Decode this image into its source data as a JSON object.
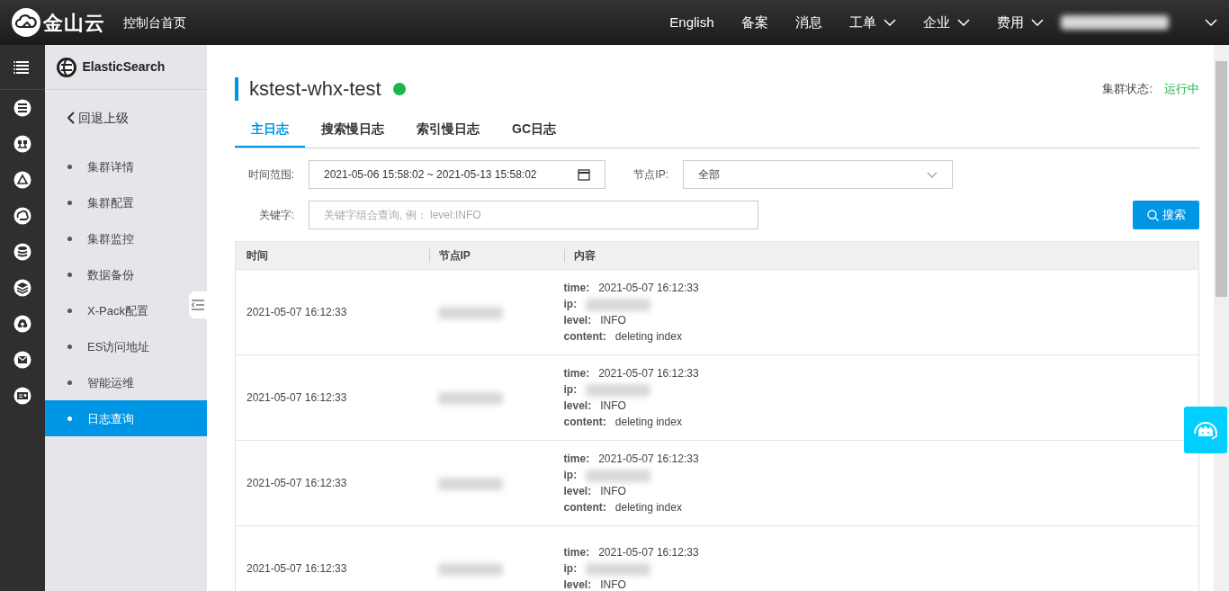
{
  "top_nav": {
    "logo_text": "金山云",
    "home": "控制台首页",
    "items": [
      {
        "label": "English",
        "dropdown": false
      },
      {
        "label": "备案",
        "dropdown": false
      },
      {
        "label": "消息",
        "dropdown": false
      },
      {
        "label": "工单",
        "dropdown": true
      },
      {
        "label": "企业",
        "dropdown": true
      },
      {
        "label": "费用",
        "dropdown": true
      }
    ]
  },
  "sidebar": {
    "product": "ElasticSearch",
    "back": "回退上级",
    "items": [
      {
        "label": "集群详情",
        "selected": false
      },
      {
        "label": "集群配置",
        "selected": false
      },
      {
        "label": "集群监控",
        "selected": false
      },
      {
        "label": "数据备份",
        "selected": false
      },
      {
        "label": "X-Pack配置",
        "selected": false
      },
      {
        "label": "ES访问地址",
        "selected": false
      },
      {
        "label": "智能运维",
        "selected": false
      },
      {
        "label": "日志查询",
        "selected": true
      }
    ]
  },
  "cluster": {
    "name": "kstest-whx-test",
    "running": true,
    "status_label": "集群状态:",
    "status_value": "运行中"
  },
  "tabs": [
    {
      "label": "主日志",
      "selected": true
    },
    {
      "label": "搜索慢日志",
      "selected": false
    },
    {
      "label": "索引慢日志",
      "selected": false
    },
    {
      "label": "GC日志",
      "selected": false
    }
  ],
  "filters": {
    "time_range": {
      "label": "时间范围:",
      "value": "2021-05-06 15:58:02 ~ 2021-05-13 15:58:02"
    },
    "node_ip": {
      "label": "节点IP:",
      "value": "全部"
    },
    "keyword": {
      "label": "关键字:",
      "placeholder": "关键字组合查询, 例： level:INFO"
    },
    "search_button": "搜索"
  },
  "table": {
    "columns": [
      "时间",
      "节点IP",
      "内容"
    ],
    "rows": [
      {
        "time": "2021-05-07 16:12:33",
        "fields": [
          {
            "kind": "text",
            "key": "time:",
            "value": "2021-05-07 16:12:33"
          },
          {
            "kind": "redacted",
            "key": "ip:"
          },
          {
            "kind": "text",
            "key": "level:",
            "value": "INFO"
          },
          {
            "kind": "text",
            "key": "content:",
            "value": "deleting index"
          }
        ]
      },
      {
        "time": "2021-05-07 16:12:33",
        "fields": [
          {
            "kind": "text",
            "key": "time:",
            "value": "2021-05-07 16:12:33"
          },
          {
            "kind": "redacted",
            "key": "ip:"
          },
          {
            "kind": "text",
            "key": "level:",
            "value": "INFO"
          },
          {
            "kind": "text",
            "key": "content:",
            "value": "deleting index"
          }
        ]
      },
      {
        "time": "2021-05-07 16:12:33",
        "fields": [
          {
            "kind": "text",
            "key": "time:",
            "value": "2021-05-07 16:12:33"
          },
          {
            "kind": "redacted",
            "key": "ip:"
          },
          {
            "kind": "text",
            "key": "level:",
            "value": "INFO"
          },
          {
            "kind": "text",
            "key": "content:",
            "value": "deleting index"
          }
        ]
      },
      {
        "time": "2021-05-07 16:12:33",
        "fields": [
          {
            "kind": "text",
            "key": "time:",
            "value": "2021-05-07 16:12:33"
          },
          {
            "kind": "redacted",
            "key": "ip:"
          },
          {
            "kind": "text",
            "key": "level:",
            "value": "INFO"
          }
        ]
      }
    ]
  }
}
